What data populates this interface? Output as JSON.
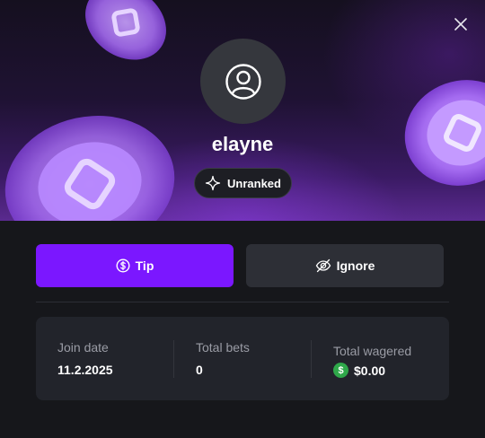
{
  "profile": {
    "username": "elayne",
    "rank": "Unranked"
  },
  "actions": {
    "tip_label": "Tip",
    "ignore_label": "Ignore"
  },
  "stats": {
    "join_date_label": "Join date",
    "join_date_value": "11.2.2025",
    "total_bets_label": "Total bets",
    "total_bets_value": "0",
    "total_wagered_label": "Total wagered",
    "total_wagered_value": "$0.00",
    "currency_symbol": "$"
  },
  "colors": {
    "accent": "#7b17ff",
    "secondary_button": "#2d2f36",
    "panel": "#22242b",
    "background": "#16171b",
    "coin": "#2fa84a"
  },
  "icons": {
    "close": "close-icon",
    "avatar": "user-icon",
    "rank": "sparkle-icon",
    "tip": "dollar-coin-icon",
    "ignore": "eye-off-icon"
  }
}
